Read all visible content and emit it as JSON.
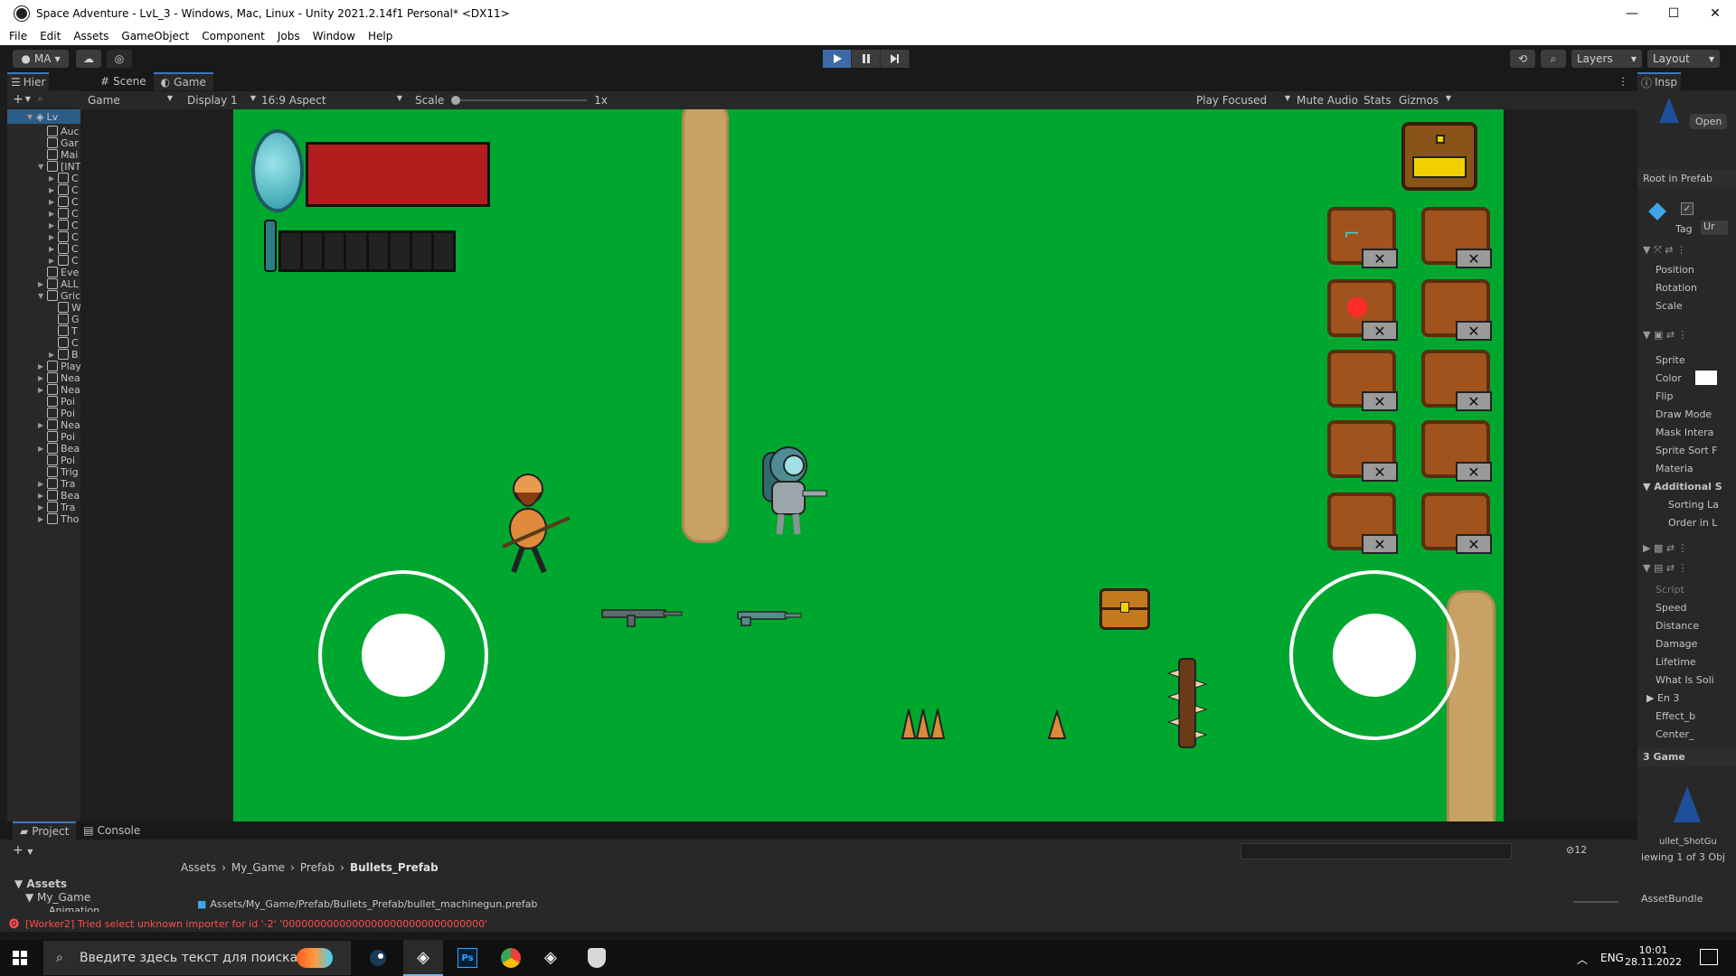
{
  "window": {
    "title": "Space Adventure - LvL_3 - Windows, Mac, Linux - Unity 2021.2.14f1 Personal* <DX11>",
    "minimize": "—",
    "maximize": "☐",
    "close": "✕"
  },
  "menu": [
    "File",
    "Edit",
    "Assets",
    "GameObject",
    "Component",
    "Jobs",
    "Window",
    "Help"
  ],
  "toolbar": {
    "account": "MA",
    "layers": "Layers",
    "layout": "Layout"
  },
  "hierarchy": {
    "tab": "Hier",
    "root": "Lv",
    "items": [
      {
        "label": "Auc",
        "indent": 2,
        "arrow": ""
      },
      {
        "label": "Gar",
        "indent": 2,
        "arrow": ""
      },
      {
        "label": "Mai",
        "indent": 2,
        "arrow": ""
      },
      {
        "label": "[INT",
        "indent": 2,
        "arrow": "▼"
      },
      {
        "label": "C",
        "indent": 3,
        "arrow": "▶"
      },
      {
        "label": "C",
        "indent": 3,
        "arrow": "▶"
      },
      {
        "label": "C",
        "indent": 3,
        "arrow": "▶"
      },
      {
        "label": "C",
        "indent": 3,
        "arrow": "▶"
      },
      {
        "label": "C",
        "indent": 3,
        "arrow": "▶"
      },
      {
        "label": "C",
        "indent": 3,
        "arrow": "▶"
      },
      {
        "label": "C",
        "indent": 3,
        "arrow": "▶"
      },
      {
        "label": "C",
        "indent": 3,
        "arrow": "▶"
      },
      {
        "label": "Eve",
        "indent": 2,
        "arrow": ""
      },
      {
        "label": "ALL",
        "indent": 2,
        "arrow": "▶"
      },
      {
        "label": "Gric",
        "indent": 2,
        "arrow": "▼"
      },
      {
        "label": "W",
        "indent": 3,
        "arrow": ""
      },
      {
        "label": "G",
        "indent": 3,
        "arrow": ""
      },
      {
        "label": "T",
        "indent": 3,
        "arrow": ""
      },
      {
        "label": "C",
        "indent": 3,
        "arrow": ""
      },
      {
        "label": "B",
        "indent": 3,
        "arrow": "▶"
      },
      {
        "label": "Play",
        "indent": 2,
        "arrow": "▶"
      },
      {
        "label": "Nea",
        "indent": 2,
        "arrow": "▶"
      },
      {
        "label": "Nea",
        "indent": 2,
        "arrow": "▶"
      },
      {
        "label": "Poi",
        "indent": 2,
        "arrow": ""
      },
      {
        "label": "Poi",
        "indent": 2,
        "arrow": ""
      },
      {
        "label": "Nea",
        "indent": 2,
        "arrow": "▶"
      },
      {
        "label": "Poi",
        "indent": 2,
        "arrow": ""
      },
      {
        "label": "Bea",
        "indent": 2,
        "arrow": "▶"
      },
      {
        "label": "Poi",
        "indent": 2,
        "arrow": ""
      },
      {
        "label": "Trig",
        "indent": 2,
        "arrow": ""
      },
      {
        "label": "Tra",
        "indent": 2,
        "arrow": "▶"
      },
      {
        "label": "Bea",
        "indent": 2,
        "arrow": "▶"
      },
      {
        "label": "Tra",
        "indent": 2,
        "arrow": "▶"
      },
      {
        "label": "Tho",
        "indent": 2,
        "arrow": "▶"
      }
    ]
  },
  "game_tabs": {
    "scene": "Scene",
    "game": "Game"
  },
  "game_bar": {
    "mode": "Game",
    "display": "Display 1",
    "aspect": "16:9 Aspect",
    "scale_label": "Scale",
    "scale_value": "1x",
    "play_focused": "Play Focused",
    "mute": "Mute Audio",
    "stats": "Stats",
    "gizmos": "Gizmos"
  },
  "inspector": {
    "tab": "Insp",
    "open": "Open",
    "root_prefab": "Root in Prefab",
    "tag_label": "Tag",
    "tag_value": "Ur",
    "transform": [
      "Position",
      "Rotation",
      "Scale"
    ],
    "sprite": [
      "Sprite",
      "Color",
      "Flip",
      "Draw Mode",
      "Mask Intera",
      "Sprite Sort F",
      "Materia"
    ],
    "additional": "Additional S",
    "sorting": [
      "Sorting La",
      "Order in L"
    ],
    "script_fields": [
      "Script",
      "Speed",
      "Distance",
      "Damage",
      "Lifetime",
      "What Is Soli",
      "En 3",
      "Effect_b",
      "Center_"
    ],
    "game_count": "3 Game",
    "preview_name": "ullet_ShotGu",
    "viewing": "iewing 1 of 3 Obj",
    "assetbundle": "AssetBundle"
  },
  "project": {
    "tab_project": "Project",
    "tab_console": "Console",
    "breadcrumb": [
      "Assets",
      "My_Game",
      "Prefab",
      "Bullets_Prefab"
    ],
    "tree": [
      "Assets",
      "My_Game",
      "Animation"
    ],
    "selected_path": "Assets/My_Game/Prefab/Bullets_Prefab/bullet_machinegun.prefab",
    "hidden_count": "12"
  },
  "console": {
    "error": "[Worker2] Tried select unknown importer for id '-2' '00000000000000000000000000000000'"
  },
  "taskbar": {
    "search_placeholder": "Введите здесь текст для поиска",
    "lang": "ENG",
    "time": "10:01",
    "date": "28.11.2022"
  },
  "colors": {
    "grass": "#00a72f",
    "path": "#c8a265",
    "health": "#b21d1d",
    "accent": "#3e6aa8"
  }
}
